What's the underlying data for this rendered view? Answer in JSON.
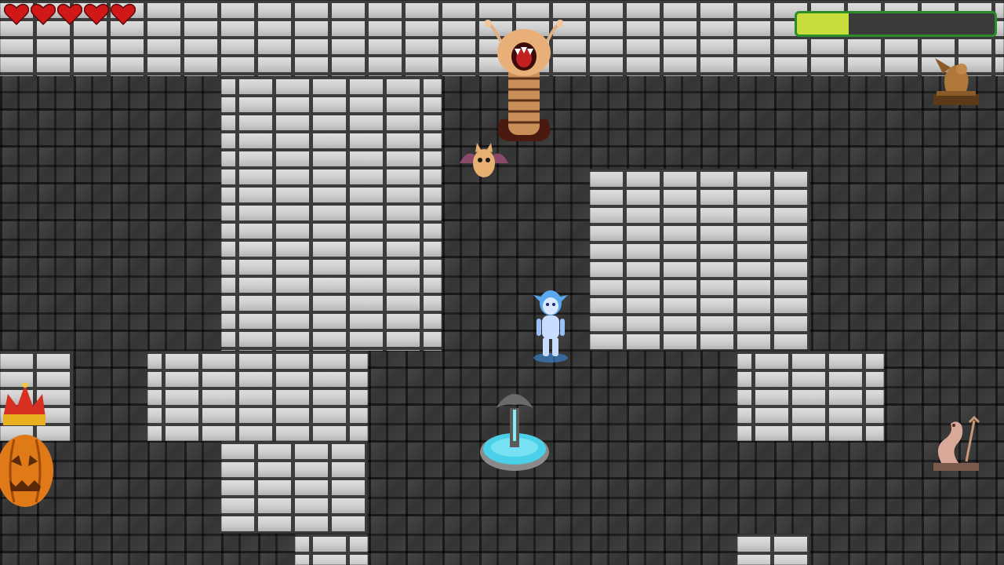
{
  "hud": {
    "hearts": {
      "current": 5,
      "max": 5,
      "color": "#d01818"
    },
    "stamina": {
      "fraction": 0.26,
      "fill_color": "#c8dc3c",
      "frame_color": "#2a8c2a"
    }
  },
  "palette": {
    "floor": "#3a3a3a",
    "wall": "#d8d8d8",
    "water": "#4ad0e8"
  },
  "sprites": [
    "player-ghost-icon",
    "worm-boss-icon",
    "bat-icon",
    "fountain-icon",
    "pumpkin-king-icon",
    "gargoyle-statue-icon",
    "sea-serpent-statue-icon"
  ]
}
